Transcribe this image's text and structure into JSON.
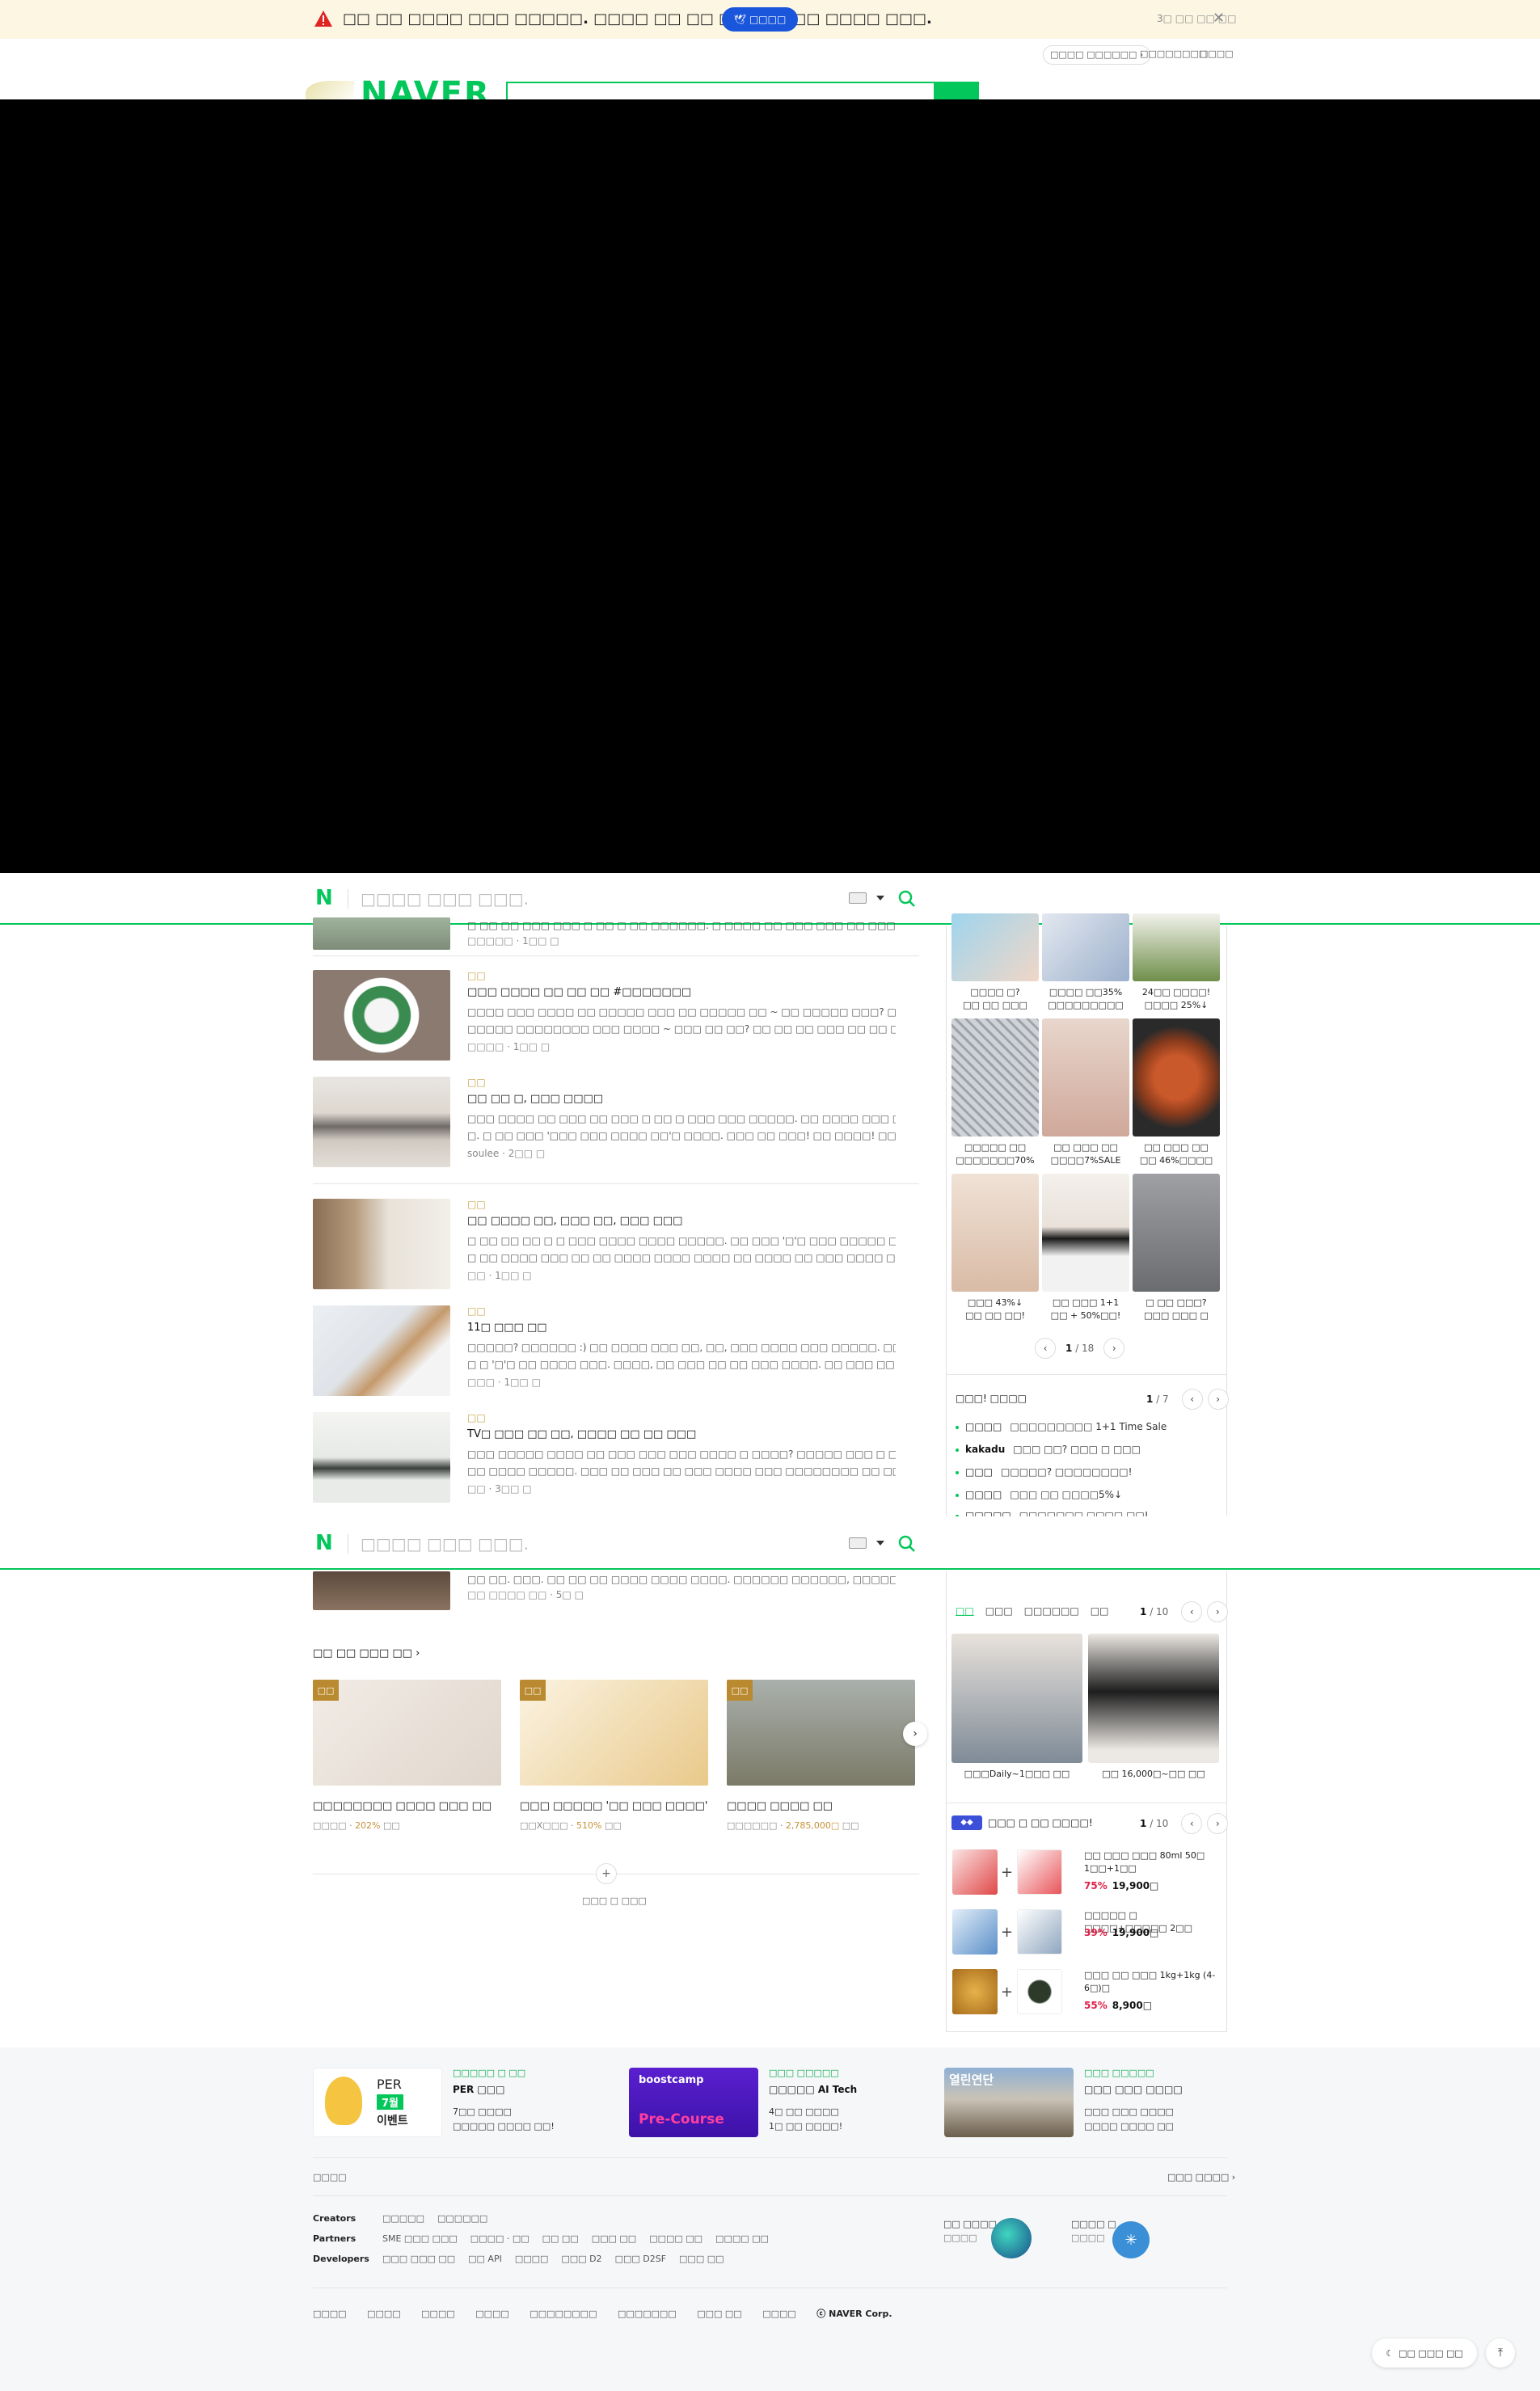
{
  "banner": {
    "message": "□□ □□ □□□□ □□□ □□□□□. □□□□ □□ □□ □□□□ □□□ □□□□ □□□.",
    "button_label": "□□□□",
    "close_text": "3□ □□ □□ □□"
  },
  "header": {
    "link1": "□□□□ □□□□□□",
    "link2": "□□□□□□□□",
    "link3": "□□□□",
    "logo_text": "NAVER"
  },
  "sticky_search": {
    "placeholder": "□□□□ □□□ □□□."
  },
  "feed": [
    {
      "meta": "□□□□□ · 1□□ □"
    },
    {
      "category": "□□",
      "title": "□□□ □□□□ □□ □□ □□ #□□□□□□□",
      "line1": "□□□□ □□□ □□□□ □□ □□□□□ □□□ □□ □□□□□ □□ ~ □□ □□□□□ □□□? □□□ □□□ □□□□ □□□□ □□□",
      "line2": "□□□□□ □□□□□□□□ □□□ □□□□ ~ □□□ □□ □□? □□ □□ □□ □□□ □□ □□ □□□□ □□ □□ □□ □□...",
      "meta": "□□□□ · 1□□ □"
    },
    {
      "category": "□□",
      "title": "□□ □□ □, □□□ □□□□",
      "line1": "□□□ □□□□ □□ □□□ □□ □□□ □ □□ □ □□□ □□□ □□□□□. □□ □□□□ □□□ □□□ □□□ □□□□□! □",
      "line2": "□. □ □□ □□□ '□□□ □□□ □□□□ □□'□ □□□□. □□□ □□ □□□! □□ □□□□! □□□! □□□ □□□□□□!! □□...",
      "meta": "soulee · 2□□ □"
    },
    {
      "category": "□□",
      "title": "□□ □□□□ □□, □□□ □□, □□□ □□□",
      "line1": "□ □□ □□ □□ □ □ □□□ □□□□ □□□□ □□□□□. □□ □□□ '□'□ □□□ □□□□□ □□□□□□ □□□□□ □□□ □□□□.",
      "line2": "□ □□ □□□□ □□□ □□ □□ □□□□ □□□□ □□□□ □□ □□□□ □□ □□□ □□□□ □□□□□□ □□□ □□ □□□ □□...",
      "meta": "□□ · 1□□ □"
    },
    {
      "category": "□□",
      "title": "11□ □□□ □□",
      "line1": "□□□□□? □□□□□□ :) □□ □□□□ □□□ □□, □□, □□□ □□□□ □□□ □□□□□. □□□□ □□ □□□□ □□□ □□ □",
      "line2": "□ □ '□'□ □□ □□□□ □□□. □□□□, □□ □□□ □□ □□ □□□ □□□□. □□ □□□ □□ □□□□□ □□□ □□ □□...",
      "meta": "□□□ · 1□□ □"
    },
    {
      "category": "□□",
      "title": "TV□ □□□ □□ □□, □□□□ □□ □□ □□□",
      "line1": "□□□ □□□□□ □□□□ □□ □□□ □□□ □□□ □□□□ □ □□□□? □□□□□ □□□ □ □□□ □□ □□□□ □□□ □□ □□",
      "line2": "□□ □□□□ □□□□□. □□□ □□ □□□ □□ □□□ □□□□ □□□ □□□□□□□□ □□ □□□□ □□□. □□□ □□□: 3...",
      "meta": "□□ · 3□□ □"
    },
    {
      "line1": "□□ □□. □□□. □□ □□ □□ □□□□ □□□□ □□□□. □□□□□□ □□□□□□, □□□□□ □□ □□□ □□ □□□ □□□□□ ...",
      "meta": "□□ □□□□ □□ · 5□ □"
    }
  ],
  "shopping_grid": {
    "captions": [
      [
        "□□□□ □?",
        "□□ □□ □□□"
      ],
      [
        "□□□□ □□35%",
        "□□□□□□□□□"
      ],
      [
        "24□□ □□□□!",
        "□□□□ 25%↓"
      ],
      [
        "□□□□□ □□",
        "□□□□□□□70%"
      ],
      [
        "□□ □□□ □□",
        "□□□□7%SALE"
      ],
      [
        "□□ □□□ □□",
        "□□ 46%□□□□"
      ],
      [
        "□□□ 43%↓",
        "□□ □□ □□!"
      ],
      [
        "□□ □□□ 1+1",
        "□□ + 50%□□!"
      ],
      [
        "□ □□ □□□?",
        "□□□ □□□ □"
      ]
    ],
    "page_current": "1",
    "page_total": "/ 18"
  },
  "brand_list": {
    "title": "□□□! □□□□",
    "page_current": "1",
    "page_total": "/ 7",
    "items": [
      {
        "brand": "□□□□",
        "text": "□□□□□□□□□ 1+1 Time Sale"
      },
      {
        "brand": "kakadu",
        "text": "□□□ □□? □□□ □ □□□"
      },
      {
        "brand": "□□□",
        "text": "□□□□□? □□□□□□□□!"
      },
      {
        "brand": "□□□□",
        "text": "□□□ □□ □□□□5%↓"
      },
      {
        "brand": "□□□□□",
        "text": "□□□□□□□ □□□□ □□!"
      }
    ]
  },
  "fashion": {
    "tabs": [
      "□□",
      "□□□",
      "□□□□□□",
      "□□"
    ],
    "page_current": "1",
    "page_total": "/ 10",
    "items": [
      "□□□Daily~1□□□ □□",
      "□□ 16,000□~□□ □□"
    ]
  },
  "deals": {
    "title": "□□□ □ □□ □□□□!",
    "page_current": "1",
    "page_total": "/ 10",
    "items": [
      {
        "name": "□□ □□□ □□□ 80ml 50□ 1□□+1□□",
        "pct": "75%",
        "price": "19,900□"
      },
      {
        "name": "□□□□□ □ □□□□+□□□□□ 2□□",
        "pct": "39%",
        "price": "19,900□"
      },
      {
        "name": "□□□ □□ □□□ 1kg+1kg (4-6□)□",
        "pct": "55%",
        "price": "8,900□"
      }
    ]
  },
  "recommend": {
    "heading": "□□ □□ □□□ □□",
    "cards": [
      {
        "badge": "□□",
        "title": "□□□□□□□□ □□□□ □□□ □□",
        "meta_prefix": "□□□□ · ",
        "meta_hl": "202%",
        "meta_suffix": " □□"
      },
      {
        "badge": "□□",
        "title": "□□□ □□□□□ '□□ □□□ □□□□'",
        "meta_prefix": "□□X□□□ · ",
        "meta_hl": "510%",
        "meta_suffix": " □□"
      },
      {
        "badge": "□□",
        "title": "□□□□ □□□□ □□",
        "meta_prefix": "□□□□□□ · ",
        "meta_hl": "2,785,000□",
        "meta_suffix": " □□"
      }
    ],
    "more_label": "□□□ □ □□□"
  },
  "footer": {
    "promos": [
      {
        "tag": "□□□□□ □ □□",
        "title": "PER □□□",
        "line1": "7□□ □□□□",
        "line2": "□□□□□ □□□□ □□!",
        "img_text1": "PER",
        "img_text2": "7월",
        "img_text3": "이벤트"
      },
      {
        "tag": "□□□ □□□□□",
        "title": "□□□□□ AI Tech",
        "line1": "4□ □□ □□□□",
        "line2": "1□ □□ □□□□!",
        "img_text1": "boostcamp",
        "img_text2": "Pre-Course"
      },
      {
        "tag": "□□□ □□□□□",
        "title": "□□□ □□□ □□□□",
        "line1": "□□□ □□□ □□□□",
        "line2": "□□□□ □□□□ □□",
        "img_text1": "열린연단"
      }
    ],
    "notice_label": "□□□□",
    "service_all": "□□□ □□□□",
    "rows": [
      {
        "label": "Creators",
        "items": [
          "□□□□□",
          "□□□□□□"
        ]
      },
      {
        "label": "Partners",
        "items": [
          "SME □□□ □□□",
          "□□□□ · □□",
          "□□ □□",
          "□□□ □□",
          "□□□□ □□",
          "□□□□ □□"
        ]
      },
      {
        "label": "Developers",
        "items": [
          "□□□ □□□ □□",
          "□□ API",
          "□□□□",
          "□□□ D2",
          "□□□ D2SF",
          "□□□ □□"
        ]
      }
    ],
    "app1_title": "□□ □□□□",
    "app1_sub": "□□□□",
    "app2_title": "□□□□ □",
    "app2_sub": "□□□□",
    "bottom": [
      "□□□□",
      "□□□□",
      "□□□□",
      "□□□□",
      "□□□□□□□□",
      "□□□□□□□",
      "□□□ □□",
      "□□□□"
    ],
    "corp": "ⓒ NAVER Corp.",
    "dark_mode": "□□ □□□ □□"
  }
}
